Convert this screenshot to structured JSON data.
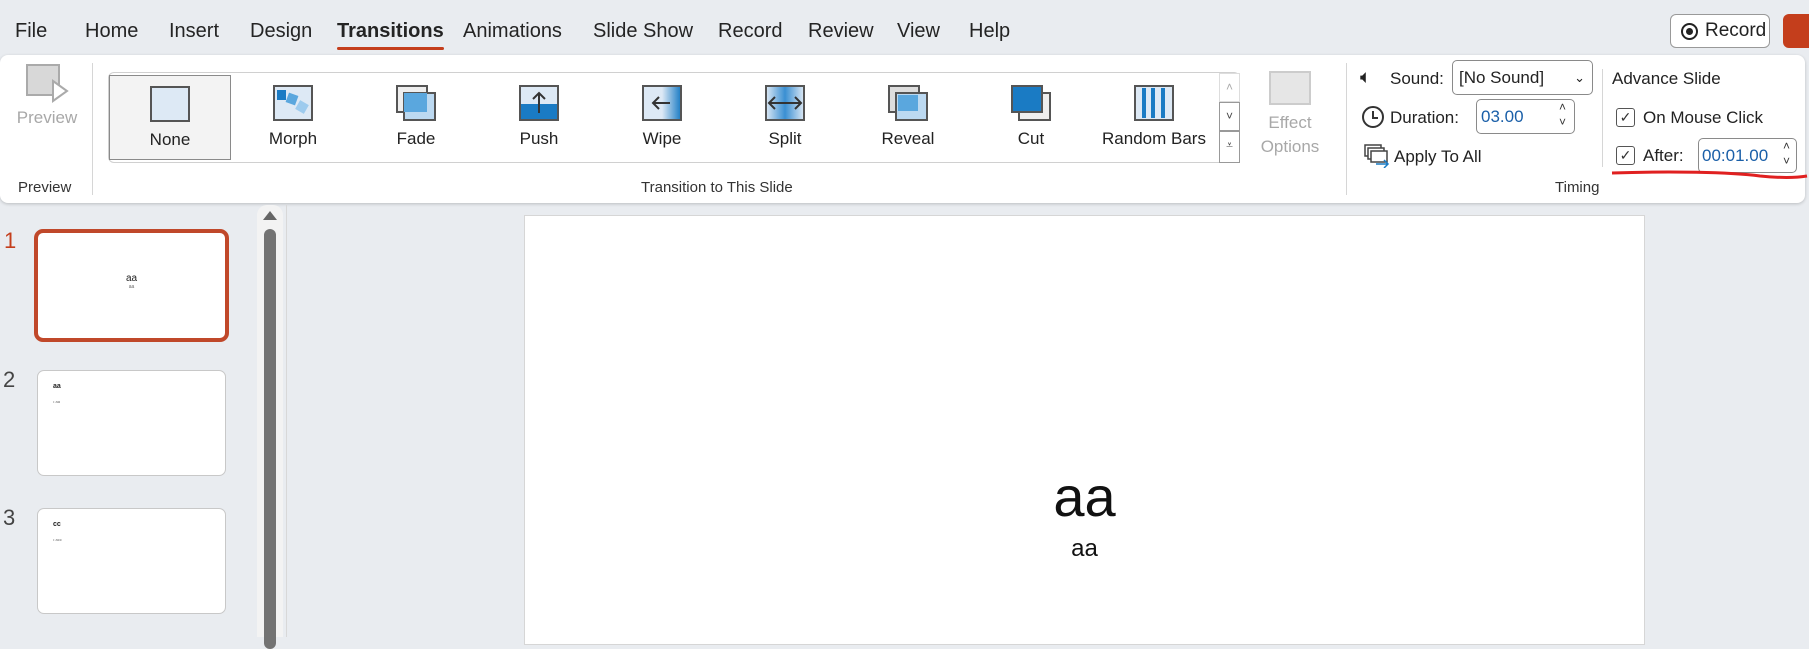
{
  "tabs": [
    "File",
    "Home",
    "Insert",
    "Design",
    "Transitions",
    "Animations",
    "Slide Show",
    "Record",
    "Review",
    "View",
    "Help"
  ],
  "active_tab": "Transitions",
  "record_button": "Record",
  "preview": {
    "button": "Preview",
    "group": "Preview"
  },
  "transitions": {
    "items": [
      "None",
      "Morph",
      "Fade",
      "Push",
      "Wipe",
      "Split",
      "Reveal",
      "Cut",
      "Random Bars"
    ],
    "selected": "None",
    "group": "Transition to This Slide",
    "effect_options": "Effect Options"
  },
  "timing": {
    "sound_label": "Sound:",
    "sound_value": "[No Sound]",
    "duration_label": "Duration:",
    "duration_value": "03.00",
    "apply_all": "Apply To All",
    "advance_title": "Advance Slide",
    "on_mouse_click": "On Mouse Click",
    "on_mouse_click_checked": true,
    "after_label": "After:",
    "after_checked": true,
    "after_value": "00:01.00",
    "group": "Timing"
  },
  "slides": [
    {
      "num": "1",
      "title": "aa",
      "body": "aa"
    },
    {
      "num": "2",
      "title": "aa",
      "body": "• aa"
    },
    {
      "num": "3",
      "title": "cc",
      "body": "• acc"
    }
  ],
  "current_slide": {
    "title": "aa",
    "subtitle": "aa"
  },
  "colors": {
    "accent": "#c43e1c",
    "annotation": "#e02020"
  }
}
